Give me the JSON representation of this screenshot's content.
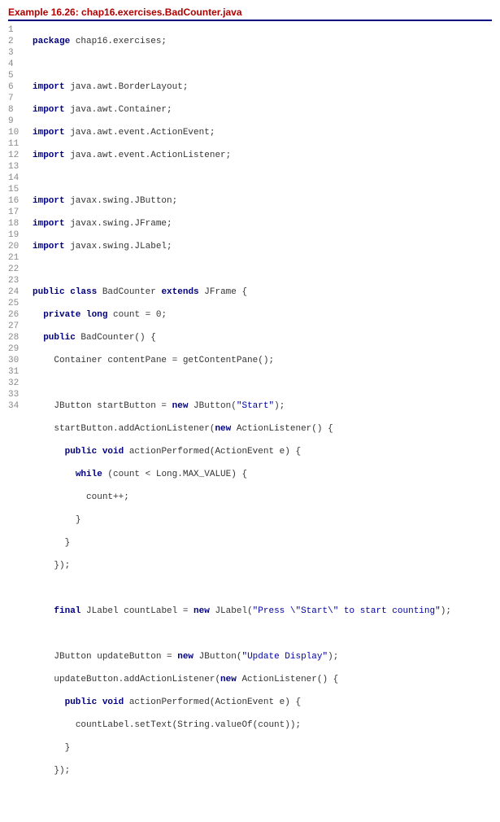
{
  "title": "Example 16.26: chap16.exercises.BadCounter.java",
  "gutter": [
    "1",
    "2",
    "3",
    "4",
    "5",
    "6",
    "7",
    "8",
    "9",
    "10",
    "11",
    "12",
    "13",
    "14",
    "15",
    "16",
    "17",
    "18",
    "19",
    "20",
    "21",
    "22",
    "23",
    "24",
    "25",
    "26",
    "27",
    "28",
    "29",
    "30",
    "31",
    "32",
    "33",
    "34"
  ],
  "code": {
    "l1": {
      "kw": "package",
      "rest": " chap16.exercises;"
    },
    "l2": {
      "blank": ""
    },
    "l3": {
      "kw": "import",
      "rest": " java.awt.BorderLayout;"
    },
    "l4": {
      "kw": "import",
      "rest": " java.awt.Container;"
    },
    "l5": {
      "kw": "import",
      "rest": " java.awt.event.ActionEvent;"
    },
    "l6": {
      "kw": "import",
      "rest": " java.awt.event.ActionListener;"
    },
    "l7": {
      "blank": ""
    },
    "l8": {
      "kw": "import",
      "rest": " javax.swing.JButton;"
    },
    "l9": {
      "kw": "import",
      "rest": " javax.swing.JFrame;"
    },
    "l10": {
      "kw": "import",
      "rest": " javax.swing.JLabel;"
    },
    "l11": {
      "blank": ""
    },
    "l12": {
      "kw1": "public",
      "kw2": "class",
      "name": " BadCounter ",
      "kw3": "extends",
      "rest": " JFrame {"
    },
    "l13": {
      "indent": "  ",
      "kw1": "private",
      "kw2": " long",
      "rest": " count = 0;"
    },
    "l14": {
      "indent": "  ",
      "kw1": "public",
      "rest": " BadCounter() {"
    },
    "l15": {
      "indent": "    ",
      "rest": "Container contentPane = getContentPane();"
    },
    "l16": {
      "blank": ""
    },
    "l17": {
      "indent": "    ",
      "pre": "JButton startButton = ",
      "kw": "new",
      "post": " JButton(",
      "str": "\"Start\"",
      "end": ");"
    },
    "l18": {
      "indent": "    ",
      "pre": "startButton.addActionListener(",
      "kw": "new",
      "post": " ActionListener() {"
    },
    "l19": {
      "indent": "      ",
      "kw1": "public",
      "kw2": " void",
      "rest": " actionPerformed(ActionEvent e) {"
    },
    "l20": {
      "indent": "        ",
      "kw": "while",
      "rest": " (count < Long.MAX_VALUE) {"
    },
    "l21": {
      "indent": "          ",
      "rest": "count++;"
    },
    "l22": {
      "indent": "        ",
      "rest": "}"
    },
    "l23": {
      "indent": "      ",
      "rest": "}"
    },
    "l24": {
      "indent": "    ",
      "rest": "});"
    },
    "l25": {
      "blank": ""
    },
    "l26": {
      "indent": "    ",
      "kw1": "final",
      "pre": " JLabel countLabel = ",
      "kw2": "new",
      "post": " JLabel(",
      "str": "\"Press \\\"Start\\\" to start counting\"",
      "end": ");"
    },
    "l27": {
      "blank": ""
    },
    "l28": {
      "indent": "    ",
      "pre": "JButton updateButton = ",
      "kw": "new",
      "post": " JButton(",
      "str": "\"Update Display\"",
      "end": ");"
    },
    "l29": {
      "indent": "    ",
      "pre": "updateButton.addActionListener(",
      "kw": "new",
      "post": " ActionListener() {"
    },
    "l30": {
      "indent": "      ",
      "kw1": "public",
      "kw2": " void",
      "rest": " actionPerformed(ActionEvent e) {"
    },
    "l31": {
      "indent": "        ",
      "rest": "countLabel.setText(String.valueOf(count));"
    },
    "l32": {
      "indent": "      ",
      "rest": "}"
    },
    "l33": {
      "indent": "    ",
      "rest": "});"
    },
    "l34": {
      "blank": ""
    }
  }
}
